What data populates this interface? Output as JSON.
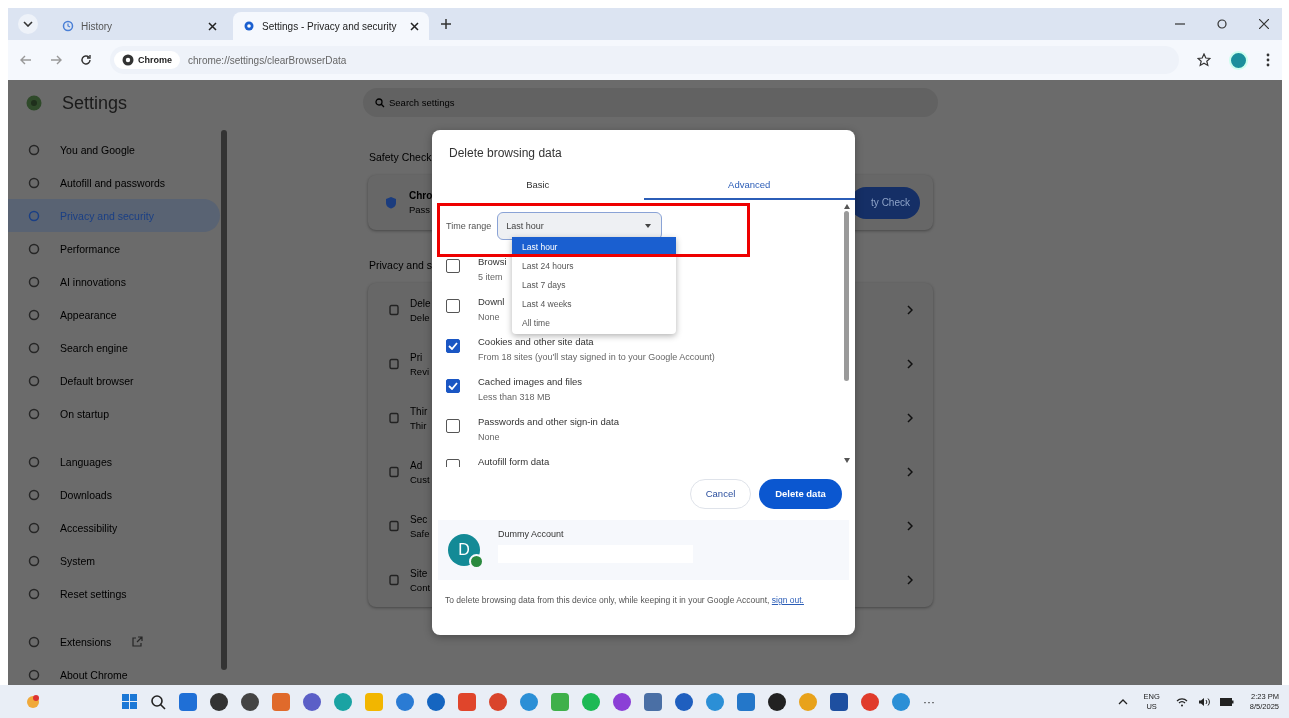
{
  "browser": {
    "tabs": [
      {
        "title": "History",
        "selected": false
      },
      {
        "title": "Settings - Privacy and security",
        "selected": true
      }
    ],
    "address": {
      "chip": "Chrome",
      "url": "chrome://settings/clearBrowserData"
    }
  },
  "settings": {
    "title": "Settings",
    "search_placeholder": "Search settings",
    "sidebar": {
      "groups": [
        [
          {
            "label": "You and Google",
            "selected": false
          },
          {
            "label": "Autofill and passwords",
            "selected": false
          },
          {
            "label": "Privacy and security",
            "selected": true
          },
          {
            "label": "Performance",
            "selected": false
          },
          {
            "label": "AI innovations",
            "selected": false
          },
          {
            "label": "Appearance",
            "selected": false
          },
          {
            "label": "Search engine",
            "selected": false
          },
          {
            "label": "Default browser",
            "selected": false
          },
          {
            "label": "On startup",
            "selected": false
          }
        ],
        [
          {
            "label": "Languages",
            "selected": false
          },
          {
            "label": "Downloads",
            "selected": false
          },
          {
            "label": "Accessibility",
            "selected": false
          },
          {
            "label": "System",
            "selected": false
          },
          {
            "label": "Reset settings",
            "selected": false
          }
        ],
        [
          {
            "label": "Extensions",
            "selected": false,
            "external": true
          },
          {
            "label": "About Chrome",
            "selected": false,
            "external": false
          }
        ]
      ]
    },
    "main": {
      "safety_heading": "Safety Check",
      "safety_card": {
        "title": "Chro",
        "subtitle": "Pass",
        "button": "ty Check"
      },
      "privacy_heading": "Privacy and s",
      "rows": [
        {
          "title": "Dele",
          "subtitle": "Dele"
        },
        {
          "title": "Pri",
          "subtitle": "Revi"
        },
        {
          "title": "Thir",
          "subtitle": "Thir"
        },
        {
          "title": "Ad",
          "subtitle": "Cust"
        },
        {
          "title": "Sec",
          "subtitle": "Safe"
        },
        {
          "title": "Site",
          "subtitle": "Cont"
        }
      ]
    }
  },
  "dialog": {
    "title": "Delete browsing data",
    "tabs": [
      {
        "label": "Basic",
        "selected": false
      },
      {
        "label": "Advanced",
        "selected": true
      }
    ],
    "time_range": {
      "label": "Time range",
      "value": "Last hour",
      "options": [
        {
          "label": "Last hour",
          "selected": true
        },
        {
          "label": "Last 24 hours",
          "selected": false
        },
        {
          "label": "Last 7 days",
          "selected": false
        },
        {
          "label": "Last 4 weeks",
          "selected": false
        },
        {
          "label": "All time",
          "selected": false
        }
      ]
    },
    "items": [
      {
        "title": "Browsi",
        "detail": "5 item",
        "checked": false
      },
      {
        "title": "Downl",
        "detail": "None",
        "checked": false
      },
      {
        "title": "Cookies and other site data",
        "detail": "From 18 sites (you'll stay signed in to your Google Account)",
        "checked": true
      },
      {
        "title": "Cached images and files",
        "detail": "Less than 318 MB",
        "checked": true
      },
      {
        "title": "Passwords and other sign-in data",
        "detail": "None",
        "checked": false
      },
      {
        "title": "Autofill form data",
        "checked": false
      }
    ],
    "cancel": "Cancel",
    "confirm": "Delete data",
    "account": {
      "initial": "D",
      "name": "Dummy Account"
    },
    "note": "To delete browsing data from this device only, while keeping it in your Google Account, ",
    "note_link": "sign out."
  },
  "taskbar": {
    "overflow": "···",
    "lang": "ENG",
    "region": "US",
    "time": "2:23 PM",
    "date": "8/5/2025"
  }
}
